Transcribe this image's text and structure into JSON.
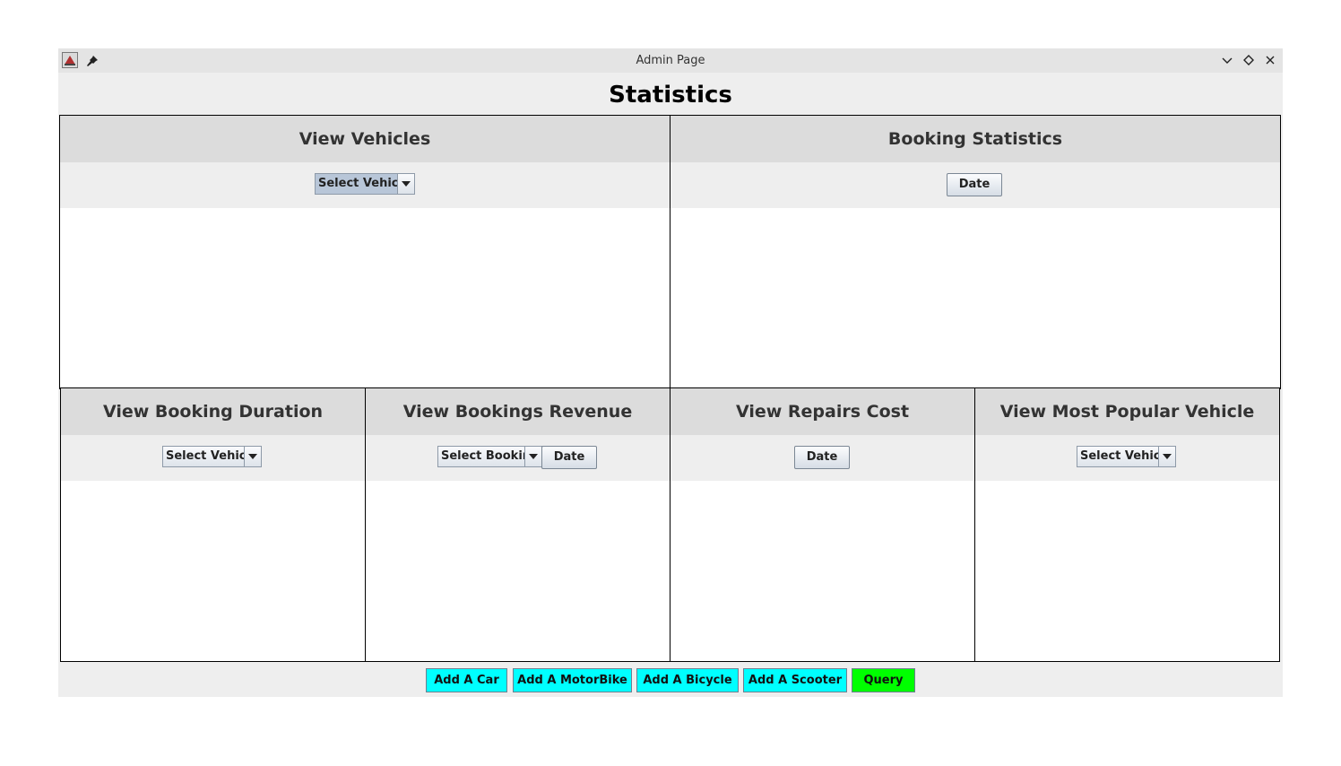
{
  "window": {
    "title": "Admin Page",
    "icons": [
      "app-icon",
      "pin-icon"
    ],
    "controls": [
      "minimize-icon",
      "maximize-icon",
      "close-icon"
    ]
  },
  "page": {
    "title": "Statistics"
  },
  "panels": {
    "view_vehicles": {
      "title": "View Vehicles",
      "combo": "Select Vehicle"
    },
    "booking_statistics": {
      "title": "Booking Statistics",
      "button": "Date"
    },
    "booking_duration": {
      "title": "View Booking Duration",
      "combo": "Select Vehicle"
    },
    "bookings_revenue": {
      "title": "View Bookings Revenue",
      "combo": "Select Booking",
      "button": "Date"
    },
    "repairs_cost": {
      "title": "View Repairs Cost",
      "button": "Date"
    },
    "popular_vehicle": {
      "title": "View Most Popular Vehicle",
      "combo": "Select Vehicle"
    }
  },
  "actions": {
    "add_car": "Add A Car",
    "add_motorbike": "Add A MotorBike",
    "add_bicycle": "Add A Bicycle",
    "add_scooter": "Add A Scooter",
    "query": "Query"
  },
  "colors": {
    "add_button": "#00ffff",
    "query_button": "#00ff00",
    "panel_header": "#dcdcdc",
    "selected_combo": "#b8c6d8"
  }
}
